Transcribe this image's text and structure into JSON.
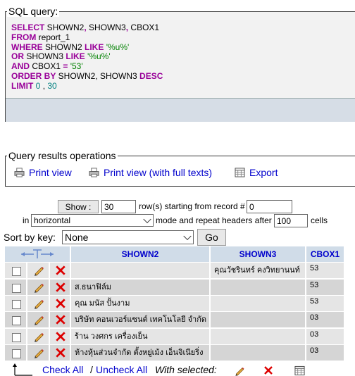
{
  "sql": {
    "legend": "SQL query:",
    "lines": [
      [
        {
          "t": "SELECT",
          "c": "kw"
        },
        {
          "t": " SHOWN2",
          "c": "pl"
        },
        {
          "t": ",",
          "c": "kw"
        },
        {
          "t": " SHOWN3",
          "c": "pl"
        },
        {
          "t": ",",
          "c": "kw"
        },
        {
          "t": " CBOX1",
          "c": "pl"
        }
      ],
      [
        {
          "t": "FROM",
          "c": "kw"
        },
        {
          "t": " report_1",
          "c": "pl"
        }
      ],
      [
        {
          "t": "WHERE",
          "c": "kw"
        },
        {
          "t": " SHOWN2 ",
          "c": "pl"
        },
        {
          "t": "LIKE",
          "c": "kw"
        },
        {
          "t": " ",
          "c": "pl"
        },
        {
          "t": "'%u%'",
          "c": "str"
        }
      ],
      [
        {
          "t": "OR",
          "c": "kw"
        },
        {
          "t": " SHOWN3 ",
          "c": "pl"
        },
        {
          "t": "LIKE",
          "c": "kw"
        },
        {
          "t": " ",
          "c": "pl"
        },
        {
          "t": "'%u%'",
          "c": "str"
        }
      ],
      [
        {
          "t": "AND",
          "c": "kw"
        },
        {
          "t": " CBOX1 ",
          "c": "pl"
        },
        {
          "t": "=",
          "c": "kw"
        },
        {
          "t": " ",
          "c": "pl"
        },
        {
          "t": "'53'",
          "c": "str"
        }
      ],
      [
        {
          "t": "ORDER BY",
          "c": "kw"
        },
        {
          "t": " SHOWN2, SHOWN3 ",
          "c": "pl"
        },
        {
          "t": "DESC",
          "c": "kw"
        }
      ],
      [
        {
          "t": "LIMIT",
          "c": "kw"
        },
        {
          "t": " ",
          "c": "pl"
        },
        {
          "t": "0",
          "c": "num"
        },
        {
          "t": " , ",
          "c": "pl"
        },
        {
          "t": "30",
          "c": "num"
        }
      ]
    ]
  },
  "ops": {
    "legend": "Query results operations",
    "print_view": "Print view",
    "print_view_full": "Print view (with full texts)",
    "export": "Export"
  },
  "nav": {
    "show_label": "Show :",
    "rows_value": "30",
    "rows_text": "row(s) starting from record #",
    "start_value": "0",
    "in_text": "in",
    "mode_value": "horizontal",
    "mode_text": "mode and repeat headers after",
    "repeat_value": "100",
    "cells_text": "cells"
  },
  "sort": {
    "label": "Sort by key:",
    "value": "None",
    "go_label": "Go"
  },
  "table": {
    "columns": [
      "SHOWN2",
      "SHOWN3",
      "CBOX1"
    ],
    "rows": [
      [
        "",
        "คุณวัชรินทร์ คงวิทยานนท์",
        "53"
      ],
      [
        "ส.ธนาฟิล์ม",
        "",
        "53"
      ],
      [
        "คุณ มนัส ปั้นงาม",
        "",
        "53"
      ],
      [
        "บริษัท คอนเวอร์แซนต์ เทคโนโลยี จำกัด",
        "",
        "03"
      ],
      [
        "ร้าน วงศกร เครื่องเย็น",
        "",
        "03"
      ],
      [
        "ห้างหุ้นส่วนจำกัด ตั้งหยู่เม้ง เอ็นจิเนียริ่ง",
        "",
        "03"
      ]
    ]
  },
  "footer": {
    "check_all": "Check All",
    "separator": "/",
    "uncheck_all": "Uncheck All",
    "with_selected": "With selected:"
  },
  "colors": {
    "link": "#0000cc",
    "keyword": "#990099",
    "string": "#008000",
    "header_bg": "#d0dce8",
    "row_odd": "#e5e5e5",
    "row_even": "#d5d5d5"
  }
}
